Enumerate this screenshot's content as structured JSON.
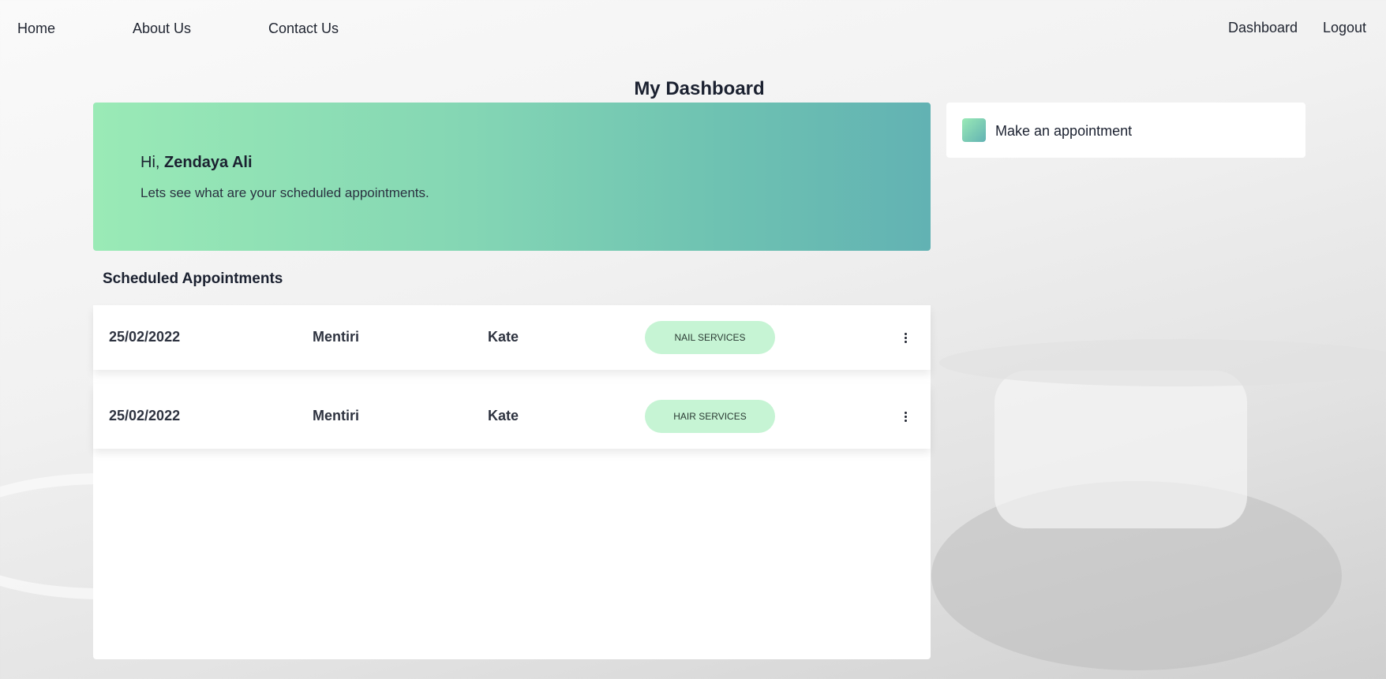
{
  "nav": {
    "home": "Home",
    "about": "About Us",
    "contact": "Contact Us",
    "dashboard": "Dashboard",
    "logout": "Logout"
  },
  "page": {
    "title": "My Dashboard"
  },
  "hero": {
    "greeting_prefix": "Hi,",
    "user_name": "Zendaya Ali",
    "subtitle": "Lets see what are your scheduled appointments."
  },
  "actions": {
    "make_appointment": "Make an appointment"
  },
  "appointments": {
    "title": "Scheduled Appointments",
    "rows": [
      {
        "date": "25/02/2022",
        "location": "Mentiri",
        "staff": "Kate",
        "service": "NAIL SERVICES"
      },
      {
        "date": "25/02/2022",
        "location": "Mentiri",
        "staff": "Kate",
        "service": "HAIR SERVICES"
      }
    ]
  },
  "icons": {
    "row_menu": "more-vertical-icon",
    "appointment_swatch": "calendar-icon"
  },
  "colors": {
    "hero_gradient_start": "#9aeab6",
    "hero_gradient_end": "#62b2b3",
    "badge_bg": "#c6f4d4"
  }
}
